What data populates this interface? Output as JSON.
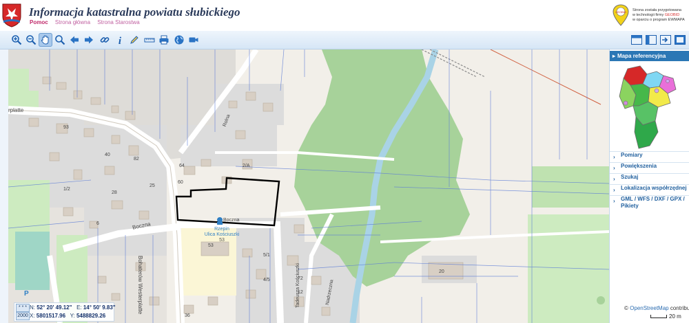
{
  "header": {
    "title": "Informacja katastralna powiatu słubickiego",
    "links": [
      "Pomoc",
      "Strona główna",
      "Strona Starostwa"
    ],
    "credit_line1": "Strona została przygotowana",
    "credit_line2": "w technologii firmy",
    "credit_brand": "GEOBID",
    "credit_line3": "w oparciu o program EWMAPA",
    "logo_text": "GEOBID"
  },
  "toolbar": {
    "tools": [
      {
        "name": "zoom-in-icon",
        "active": false
      },
      {
        "name": "zoom-out-icon",
        "active": false
      },
      {
        "name": "pan-hand-icon",
        "active": true
      },
      {
        "name": "zoom-window-icon",
        "active": false
      },
      {
        "name": "arrow-back-icon",
        "active": false
      },
      {
        "name": "arrow-forward-icon",
        "active": false
      },
      {
        "name": "link-icon",
        "active": false
      },
      {
        "name": "info-icon",
        "active": false
      },
      {
        "name": "pencil-icon",
        "active": false
      },
      {
        "name": "measure-icon",
        "active": false
      },
      {
        "name": "print-icon",
        "active": false
      },
      {
        "name": "globe-icon",
        "active": false
      },
      {
        "name": "camera-icon",
        "active": false
      }
    ],
    "panel_buttons": [
      "panel-layout-1-icon",
      "panel-layout-2-icon",
      "export-icon",
      "fullscreen-icon"
    ]
  },
  "sidebar": {
    "reference_title": "Mapa referencyjna",
    "menu": [
      "Pomiary",
      "Powiększenia",
      "Szukaj",
      "Lokalizacja współrzędnej",
      "GML / WFS / DXF / GPX / Pikiety"
    ]
  },
  "map": {
    "streets": [
      "Boczna",
      "Bohaterów Westerplatte",
      "Rolna",
      "Boczna",
      "Tadeusza Kościuszki",
      "Nadrzeczna",
      "rplatte"
    ],
    "parcels": [
      "93",
      "82",
      "64",
      "2/A",
      "60",
      "25",
      "40",
      "6",
      "53",
      "20",
      "5/1",
      "4/5",
      "72",
      "12",
      "36",
      "1/2",
      "28"
    ],
    "poi_line1": "Rzepin",
    "poi_line2": "Ulica Kościuszki",
    "poi_line3": "53"
  },
  "coordinates": {
    "lat_label": "N:",
    "lat": "52° 20' 49.12\"",
    "lon_label": "E:",
    "lon": "14° 50' 9.83\"",
    "x_label": "X:",
    "x": "5801517.96",
    "y_label": "Y:",
    "y": "5488829.26",
    "mode_top": "* * *",
    "mode_bottom": "2000"
  },
  "attribution": {
    "prefix": "©",
    "link": "OpenStreetMap",
    "suffix": "contributors"
  },
  "scale": "20 m",
  "colors": {
    "accent": "#2b77b5",
    "forest": "#a7d29a",
    "grass": "#cdebc0",
    "building": "#d8cfc4",
    "residential": "#dcdcdc",
    "river": "#a9d3e6",
    "selection": "#000000",
    "parcel_line": "#5b7bd6"
  }
}
